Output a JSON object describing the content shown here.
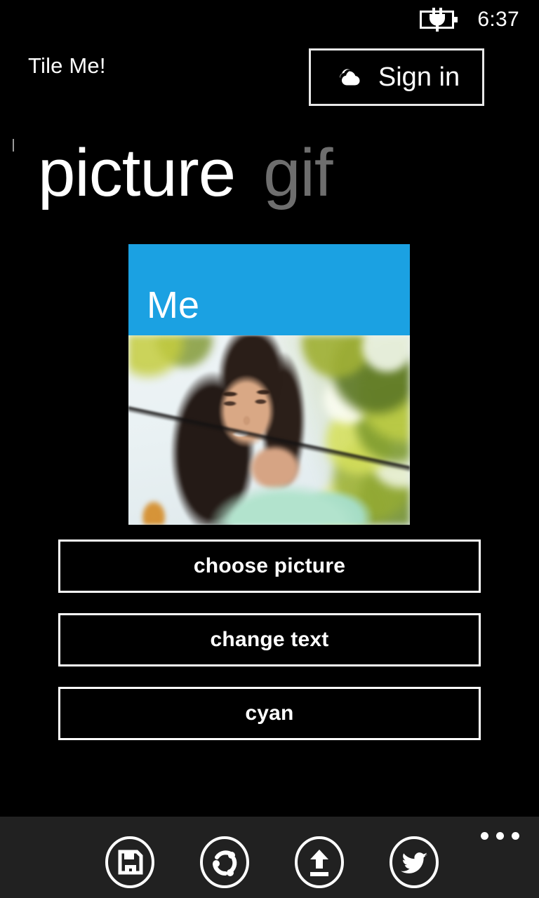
{
  "status_bar": {
    "battery_icon": "battery-charging-icon",
    "time": "6:37"
  },
  "header": {
    "app_title": "Tile Me!",
    "sign_in": {
      "label": "Sign in",
      "icon": "onedrive-cloud-icon"
    }
  },
  "pivot": {
    "items": [
      {
        "label": "picture",
        "state": "active"
      },
      {
        "label": "gif",
        "state": "inactive"
      }
    ]
  },
  "tile_preview": {
    "tile_text": "Me",
    "tile_color": "#1ba1e2",
    "photo_alt": "portrait-photo"
  },
  "actions": [
    {
      "label": "choose picture",
      "name": "choose-picture-button"
    },
    {
      "label": "change text",
      "name": "change-text-button"
    },
    {
      "label": "cyan",
      "name": "tile-color-button"
    }
  ],
  "app_bar": {
    "buttons": [
      {
        "icon": "save-icon",
        "name": "save-button"
      },
      {
        "icon": "share-icon",
        "name": "share-button"
      },
      {
        "icon": "upload-icon",
        "name": "upload-button"
      },
      {
        "icon": "twitter-icon",
        "name": "twitter-button"
      }
    ],
    "overflow_label": "..."
  },
  "colors": {
    "accent_cyan": "#1ba1e2",
    "page_background": "#000000",
    "appbar_background": "#212121",
    "inactive_text": "#6e6e6e"
  }
}
